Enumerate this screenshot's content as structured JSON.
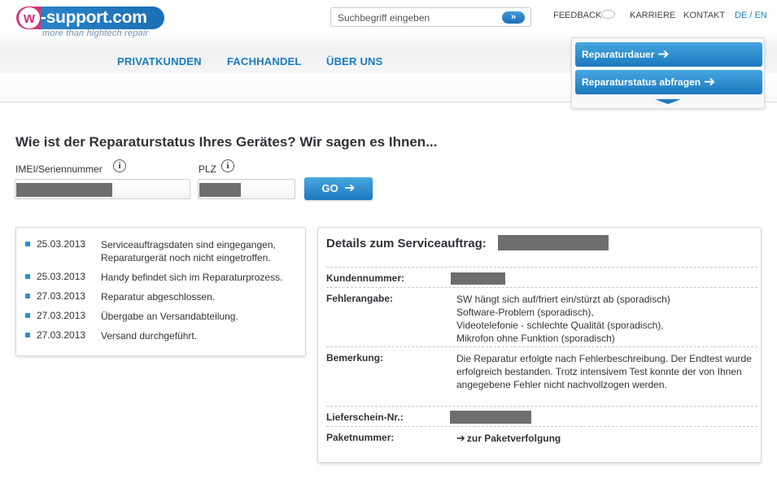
{
  "brand": {
    "logo_text": "w-support.com",
    "logo_letter": "w",
    "logo_name": "-support.com",
    "tagline": "more than hightech repair"
  },
  "search": {
    "placeholder": "Suchbegriff eingeben",
    "button_glyph": "»"
  },
  "toplinks": {
    "feedback": "FEEDBACK",
    "karriere": "KARRIERE",
    "kontakt": "KONTAKT",
    "language": "DE / EN"
  },
  "nav": {
    "items": [
      "PRIVATKUNDEN",
      "FACHHANDEL",
      "ÜBER UNS"
    ]
  },
  "quick_panel": {
    "items": [
      "Reparaturdauer",
      "Reparaturstatus abfragen"
    ]
  },
  "form": {
    "headline": "Wie ist der Reparaturstatus Ihres Gerätes? Wir sagen es Ihnen...",
    "imei_label": "IMEI/Seriennummer",
    "plz_label": "PLZ",
    "info_glyph": "i",
    "go_label": "GO"
  },
  "status_log": [
    {
      "date": "25.03.2013",
      "text": "Serviceauftragsdaten sind eingegangen, Reparaturgerät noch nicht eingetroffen."
    },
    {
      "date": "25.03.2013",
      "text": "Handy befindet sich im Reparaturprozess."
    },
    {
      "date": "27.03.2013",
      "text": "Reparatur abgeschlossen."
    },
    {
      "date": "27.03.2013",
      "text": "Übergabe an Versandabteilung."
    },
    {
      "date": "27.03.2013",
      "text": "Versand durchgeführt."
    }
  ],
  "details": {
    "title": "Details zum Serviceauftrag:",
    "kundennummer_label": "Kundennummer:",
    "fehlerangabe_label": "Fehlerangabe:",
    "fehlerangabe_lines": [
      "SW hängt sich auf/friert ein/stürzt ab (sporadisch)",
      "Software-Problem (sporadisch),",
      "Videotelefonie - schlechte Qualität (sporadisch),",
      "Mikrofon ohne Funktion (sporadisch)"
    ],
    "bemerkung_label": "Bemerkung:",
    "bemerkung_text": "Die Reparatur erfolgte nach Fehlerbeschreibung. Der Endtest wurde erfolgreich bestanden. Trotz intensivem Test konnte der von Ihnen angegebene Fehler nicht nachvollzogen werden.",
    "lieferschein_label": "Lieferschein-Nr.:",
    "paketnummer_label": "Paketnummer:",
    "tracking_link": "zur Paketverfolgung"
  },
  "colors": {
    "accent": "#1b7bbf",
    "brand_pink": "#d63374",
    "redaction": "#6e6e6e"
  }
}
